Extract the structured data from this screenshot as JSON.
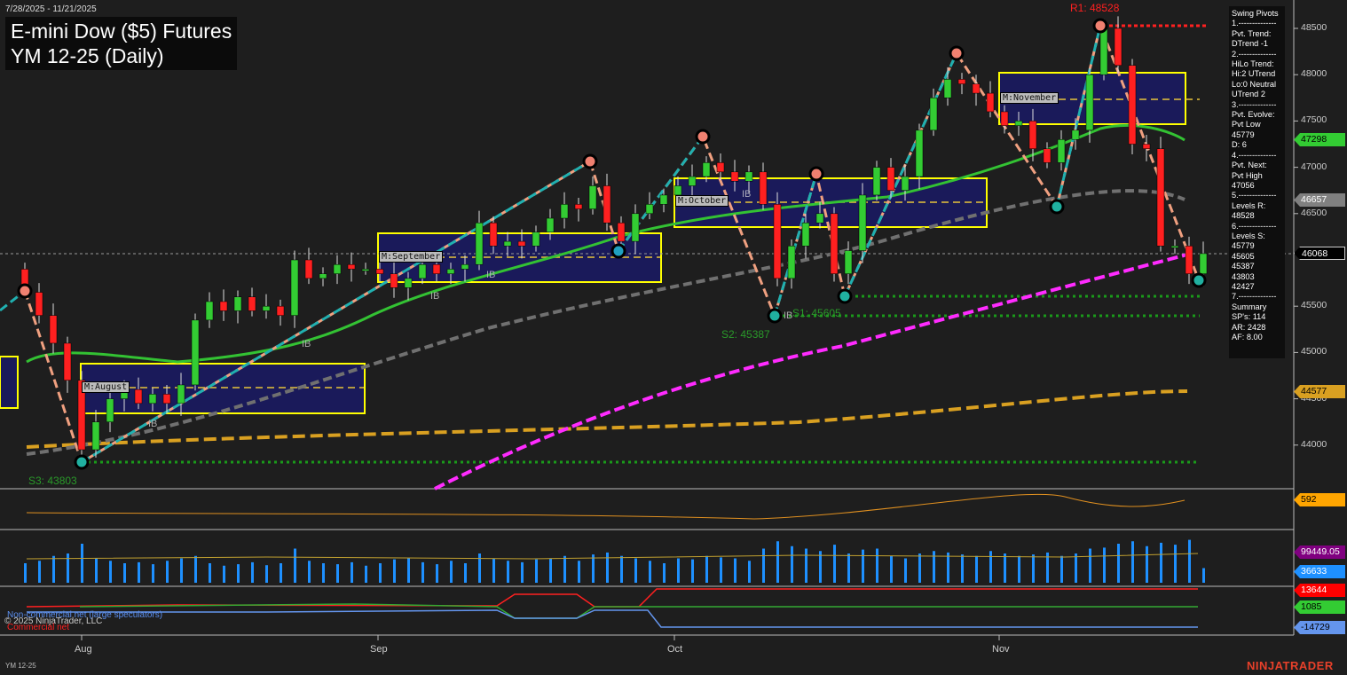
{
  "header": {
    "date_range": "7/28/2025 - 11/21/2025",
    "title": "E-mini Dow ($5) Futures",
    "subtitle": "YM 12-25 (Daily)"
  },
  "info_panel": [
    "Swing Pivots",
    "1.--------------",
    "Pvt. Trend:",
    "DTrend -1",
    "2.--------------",
    "HiLo Trend:",
    "Hi:2 UTrend",
    "Lo:0 Neutral",
    "UTrend 2",
    "3.--------------",
    "Pvt. Evolve:",
    "Pvt Low",
    "45779",
    "D: 6",
    "4.--------------",
    "Pvt. Next:",
    "Pvt High",
    "47056",
    "5.--------------",
    "Levels R:",
    "48528",
    "6.--------------",
    "Levels S:",
    "45779",
    "45605",
    "45387",
    "43803",
    "42427",
    "7.--------------",
    "Summary",
    "SP's: 114",
    "AR: 2428",
    "AF: 8.00"
  ],
  "annotations": {
    "r1": "R1: 48528",
    "s1": "S1: 45605",
    "s2": "S2: 45387",
    "s3": "S3: 43803",
    "months": [
      "M:August",
      "M:September",
      "M:October",
      "M:November"
    ],
    "ib": "IB"
  },
  "price_tags": [
    {
      "value": "47298",
      "bg": "#33cc33",
      "fg": "#000"
    },
    {
      "value": "46657",
      "bg": "#808080",
      "fg": "#fff"
    },
    {
      "value": "46068",
      "bg": "#000000",
      "fg": "#fff"
    },
    {
      "value": "44577",
      "bg": "#d9a021",
      "fg": "#000"
    }
  ],
  "indicator_tags": [
    {
      "value": "592",
      "bg": "#ffa500",
      "fg": "#000"
    },
    {
      "value": "99449.05",
      "bg": "#800080",
      "fg": "#fff"
    },
    {
      "value": "36633",
      "bg": "#1e90ff",
      "fg": "#fff"
    },
    {
      "value": "13644",
      "bg": "#ff0000",
      "fg": "#fff"
    },
    {
      "value": "1085",
      "bg": "#33cc33",
      "fg": "#000"
    },
    {
      "value": "-14729",
      "bg": "#6495ed",
      "fg": "#000"
    }
  ],
  "legend": {
    "noncommercial": "Non-commercial net (large speculators)",
    "copyright": "© 2025 NinjaTrader, LLC",
    "commercial": "Commercial net"
  },
  "footer": {
    "instrument": "YM 12-25",
    "brand": "NINJATRADER"
  },
  "chart_data": {
    "type": "candlestick",
    "title": "E-mini Dow ($5) Futures YM 12-25 (Daily)",
    "y_ticks": [
      48500,
      48000,
      47500,
      47000,
      46500,
      45500,
      45000,
      44500,
      44000
    ],
    "ylim": [
      43500,
      48700
    ],
    "x_ticks": [
      "Aug",
      "Sep",
      "Oct",
      "Nov"
    ],
    "closes": [
      45650,
      45400,
      45100,
      44700,
      43950,
      44250,
      44500,
      44600,
      44450,
      44550,
      44450,
      44650,
      45350,
      45550,
      45450,
      45600,
      45450,
      45500,
      45400,
      46000,
      45800,
      45850,
      45950,
      45900,
      45900,
      45850,
      45700,
      45800,
      45950,
      45850,
      45900,
      45950,
      46400,
      46150,
      46200,
      46150,
      46300,
      46450,
      46600,
      46550,
      46800,
      46400,
      46200,
      46500,
      46600,
      46700,
      46800,
      46900,
      47050,
      46950,
      46850,
      46950,
      46600,
      45800,
      46150,
      46400,
      46500,
      45850,
      46100,
      46700,
      47000,
      46750,
      46900,
      47400,
      47750,
      47950,
      47900,
      47800,
      47600,
      47450,
      47500,
      47200,
      47050,
      47300,
      47400,
      48000,
      48500,
      48100,
      47250,
      47200,
      46150,
      46150,
      45850,
      46068
    ],
    "volume": [
      40,
      45,
      55,
      60,
      80,
      50,
      45,
      40,
      42,
      38,
      45,
      50,
      55,
      40,
      35,
      38,
      42,
      36,
      40,
      70,
      45,
      40,
      38,
      42,
      35,
      40,
      48,
      50,
      42,
      38,
      45,
      40,
      60,
      50,
      45,
      42,
      48,
      50,
      55,
      45,
      58,
      62,
      55,
      50,
      45,
      40,
      50,
      48,
      55,
      52,
      50,
      45,
      70,
      85,
      75,
      70,
      65,
      78,
      60,
      68,
      70,
      55,
      50,
      60,
      65,
      62,
      58,
      55,
      65,
      60,
      55,
      58,
      62,
      55,
      60,
      70,
      72,
      80,
      85,
      75,
      82,
      78,
      88,
      30
    ],
    "levels": {
      "R1": 48528,
      "S1": 45605,
      "S2": 45387,
      "S3": 43803
    }
  }
}
